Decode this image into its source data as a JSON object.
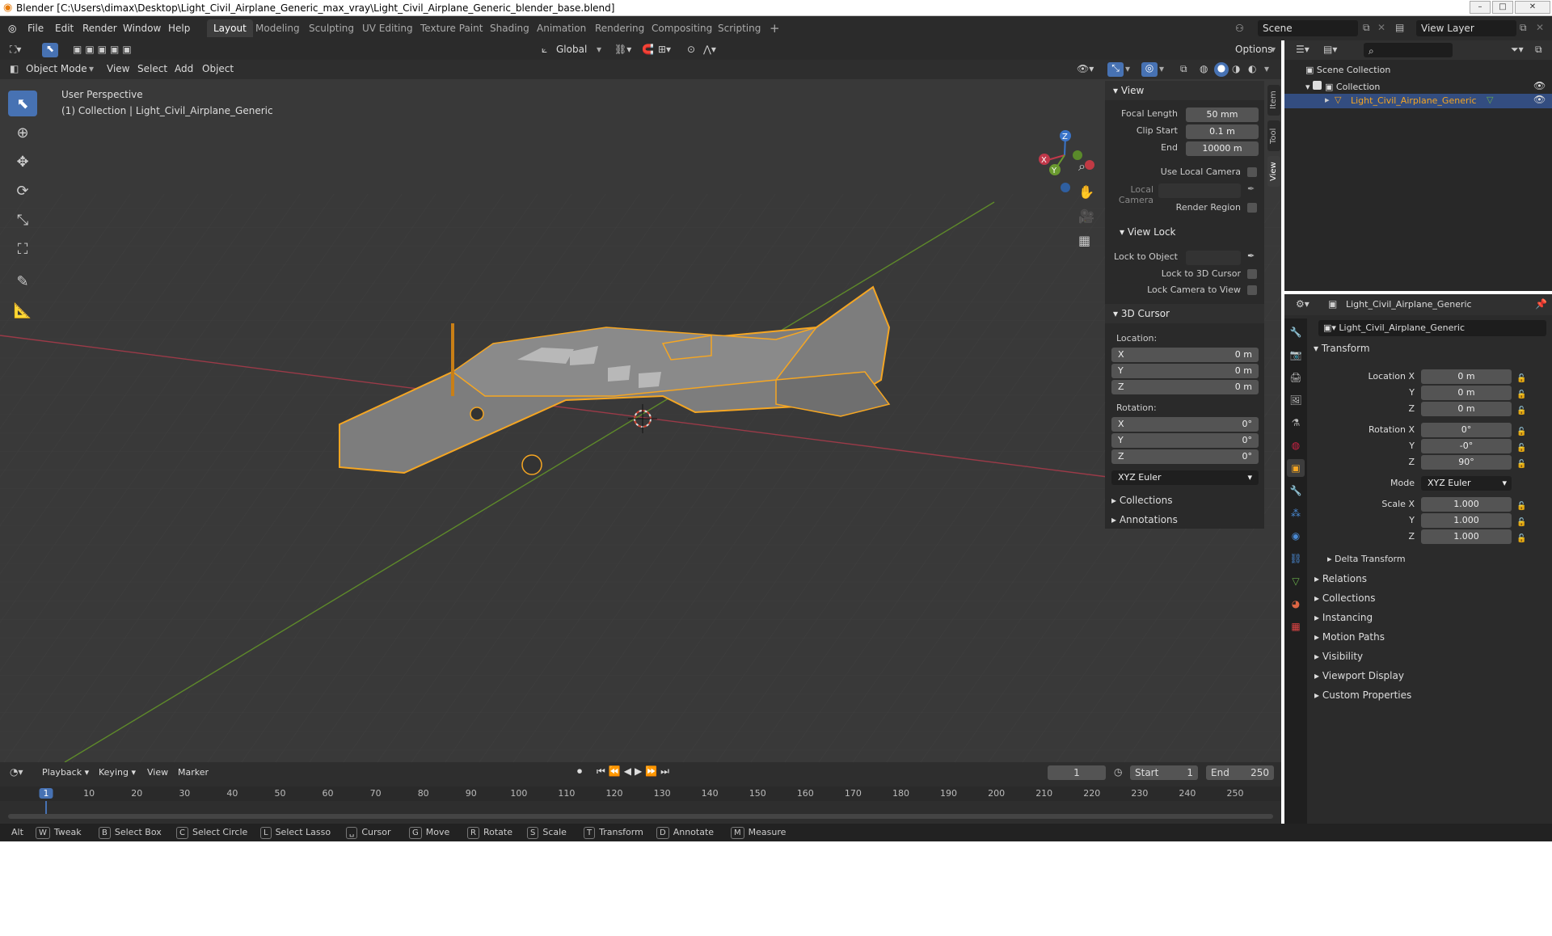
{
  "titlebar": {
    "title": "Blender [C:\\Users\\dimax\\Desktop\\Light_Civil_Airplane_Generic_max_vray\\Light_Civil_Airplane_Generic_blender_base.blend]"
  },
  "menu": {
    "file": "File",
    "edit": "Edit",
    "render": "Render",
    "window": "Window",
    "help": "Help"
  },
  "workspaces": [
    "Layout",
    "Modeling",
    "Sculpting",
    "UV Editing",
    "Texture Paint",
    "Shading",
    "Animation",
    "Rendering",
    "Compositing",
    "Scripting"
  ],
  "add_tab": "+",
  "scene": {
    "name": "Scene",
    "view_layer": "View Layer"
  },
  "viewport_header": {
    "mode": "Object Mode",
    "view": "View",
    "select": "Select",
    "add": "Add",
    "object": "Object",
    "orientation": "Global",
    "options": "Options"
  },
  "viewport": {
    "perspective": "User Perspective",
    "collection_info": "(1) Collection | Light_Civil_Airplane_Generic",
    "gizmo_x": "X",
    "gizmo_y": "Y",
    "gizmo_z": "Z"
  },
  "npanel": {
    "tabs": [
      "Item",
      "Tool",
      "View"
    ],
    "view_header": "View",
    "focal_length_label": "Focal Length",
    "focal_length": "50 mm",
    "clip_start_label": "Clip Start",
    "clip_start": "0.1 m",
    "end_label": "End",
    "end": "10000 m",
    "use_local_camera": "Use Local Camera",
    "local_camera": "Local Camera",
    "render_region": "Render Region",
    "view_lock_header": "View Lock",
    "lock_to_object": "Lock to Object",
    "lock_to_3d_cursor": "Lock to 3D Cursor",
    "lock_camera_to_view": "Lock Camera to View",
    "cursor_header": "3D Cursor",
    "location_label": "Location:",
    "loc": [
      {
        "axis": "X",
        "value": "0 m"
      },
      {
        "axis": "Y",
        "value": "0 m"
      },
      {
        "axis": "Z",
        "value": "0 m"
      }
    ],
    "rotation_label": "Rotation:",
    "rot": [
      {
        "axis": "X",
        "value": "0°"
      },
      {
        "axis": "Y",
        "value": "0°"
      },
      {
        "axis": "Z",
        "value": "0°"
      }
    ],
    "rotation_mode": "XYZ Euler",
    "collections": "Collections",
    "annotations": "Annotations"
  },
  "outliner": {
    "scene_collection": "Scene Collection",
    "collection": "Collection",
    "object": "Light_Civil_Airplane_Generic"
  },
  "properties": {
    "object_name": "Light_Civil_Airplane_Generic",
    "datablock": "Light_Civil_Airplane_Generic",
    "transform_header": "Transform",
    "location_x_label": "Location X",
    "location_x": "0 m",
    "y_label": "Y",
    "location_y": "0 m",
    "z_label": "Z",
    "location_z": "0 m",
    "rotation_x_label": "Rotation X",
    "rotation_x": "0°",
    "rotation_y": "-0°",
    "rotation_z": "90°",
    "mode_label": "Mode",
    "mode": "XYZ Euler",
    "scale_x_label": "Scale X",
    "scale_x": "1.000",
    "scale_y": "1.000",
    "scale_z": "1.000",
    "delta_transform": "Delta Transform",
    "sections": [
      "Relations",
      "Collections",
      "Instancing",
      "Motion Paths",
      "Visibility",
      "Viewport Display",
      "Custom Properties"
    ]
  },
  "timeline": {
    "playback": "Playback",
    "keying": "Keying",
    "view": "View",
    "marker": "Marker",
    "current_frame": "1",
    "start_label": "Start",
    "start": "1",
    "end_label": "End",
    "end": "250",
    "ruler": [
      "1",
      "10",
      "20",
      "30",
      "40",
      "50",
      "60",
      "70",
      "80",
      "90",
      "100",
      "110",
      "120",
      "130",
      "140",
      "150",
      "160",
      "170",
      "180",
      "190",
      "200",
      "210",
      "220",
      "230",
      "240",
      "250"
    ]
  },
  "statusbar": {
    "alt": "Alt",
    "items": [
      {
        "key": "W",
        "label": "Tweak"
      },
      {
        "key": "B",
        "label": "Select Box"
      },
      {
        "key": "C",
        "label": "Select Circle"
      },
      {
        "key": "L",
        "label": "Select Lasso"
      },
      {
        "key": "␣",
        "label": "Cursor"
      },
      {
        "key": "G",
        "label": "Move"
      },
      {
        "key": "R",
        "label": "Rotate"
      },
      {
        "key": "S",
        "label": "Scale"
      },
      {
        "key": "T",
        "label": "Transform"
      },
      {
        "key": "D",
        "label": "Annotate"
      },
      {
        "key": "M",
        "label": "Measure"
      }
    ]
  },
  "colors": {
    "accent": "#4772b3",
    "selection": "#f5a623",
    "x_axis": "#c0384a",
    "y_axis": "#6a9a2f",
    "z_axis": "#3a74c9"
  }
}
